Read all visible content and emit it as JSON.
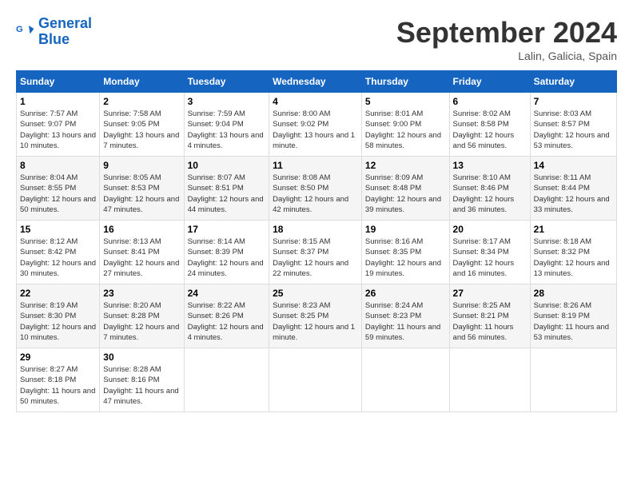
{
  "logo": {
    "line1": "General",
    "line2": "Blue"
  },
  "title": "September 2024",
  "location": "Lalin, Galicia, Spain",
  "weekdays": [
    "Sunday",
    "Monday",
    "Tuesday",
    "Wednesday",
    "Thursday",
    "Friday",
    "Saturday"
  ],
  "weeks": [
    [
      {
        "day": "1",
        "info": "Sunrise: 7:57 AM\nSunset: 9:07 PM\nDaylight: 13 hours and 10 minutes."
      },
      {
        "day": "2",
        "info": "Sunrise: 7:58 AM\nSunset: 9:05 PM\nDaylight: 13 hours and 7 minutes."
      },
      {
        "day": "3",
        "info": "Sunrise: 7:59 AM\nSunset: 9:04 PM\nDaylight: 13 hours and 4 minutes."
      },
      {
        "day": "4",
        "info": "Sunrise: 8:00 AM\nSunset: 9:02 PM\nDaylight: 13 hours and 1 minute."
      },
      {
        "day": "5",
        "info": "Sunrise: 8:01 AM\nSunset: 9:00 PM\nDaylight: 12 hours and 58 minutes."
      },
      {
        "day": "6",
        "info": "Sunrise: 8:02 AM\nSunset: 8:58 PM\nDaylight: 12 hours and 56 minutes."
      },
      {
        "day": "7",
        "info": "Sunrise: 8:03 AM\nSunset: 8:57 PM\nDaylight: 12 hours and 53 minutes."
      }
    ],
    [
      {
        "day": "8",
        "info": "Sunrise: 8:04 AM\nSunset: 8:55 PM\nDaylight: 12 hours and 50 minutes."
      },
      {
        "day": "9",
        "info": "Sunrise: 8:05 AM\nSunset: 8:53 PM\nDaylight: 12 hours and 47 minutes."
      },
      {
        "day": "10",
        "info": "Sunrise: 8:07 AM\nSunset: 8:51 PM\nDaylight: 12 hours and 44 minutes."
      },
      {
        "day": "11",
        "info": "Sunrise: 8:08 AM\nSunset: 8:50 PM\nDaylight: 12 hours and 42 minutes."
      },
      {
        "day": "12",
        "info": "Sunrise: 8:09 AM\nSunset: 8:48 PM\nDaylight: 12 hours and 39 minutes."
      },
      {
        "day": "13",
        "info": "Sunrise: 8:10 AM\nSunset: 8:46 PM\nDaylight: 12 hours and 36 minutes."
      },
      {
        "day": "14",
        "info": "Sunrise: 8:11 AM\nSunset: 8:44 PM\nDaylight: 12 hours and 33 minutes."
      }
    ],
    [
      {
        "day": "15",
        "info": "Sunrise: 8:12 AM\nSunset: 8:42 PM\nDaylight: 12 hours and 30 minutes."
      },
      {
        "day": "16",
        "info": "Sunrise: 8:13 AM\nSunset: 8:41 PM\nDaylight: 12 hours and 27 minutes."
      },
      {
        "day": "17",
        "info": "Sunrise: 8:14 AM\nSunset: 8:39 PM\nDaylight: 12 hours and 24 minutes."
      },
      {
        "day": "18",
        "info": "Sunrise: 8:15 AM\nSunset: 8:37 PM\nDaylight: 12 hours and 22 minutes."
      },
      {
        "day": "19",
        "info": "Sunrise: 8:16 AM\nSunset: 8:35 PM\nDaylight: 12 hours and 19 minutes."
      },
      {
        "day": "20",
        "info": "Sunrise: 8:17 AM\nSunset: 8:34 PM\nDaylight: 12 hours and 16 minutes."
      },
      {
        "day": "21",
        "info": "Sunrise: 8:18 AM\nSunset: 8:32 PM\nDaylight: 12 hours and 13 minutes."
      }
    ],
    [
      {
        "day": "22",
        "info": "Sunrise: 8:19 AM\nSunset: 8:30 PM\nDaylight: 12 hours and 10 minutes."
      },
      {
        "day": "23",
        "info": "Sunrise: 8:20 AM\nSunset: 8:28 PM\nDaylight: 12 hours and 7 minutes."
      },
      {
        "day": "24",
        "info": "Sunrise: 8:22 AM\nSunset: 8:26 PM\nDaylight: 12 hours and 4 minutes."
      },
      {
        "day": "25",
        "info": "Sunrise: 8:23 AM\nSunset: 8:25 PM\nDaylight: 12 hours and 1 minute."
      },
      {
        "day": "26",
        "info": "Sunrise: 8:24 AM\nSunset: 8:23 PM\nDaylight: 11 hours and 59 minutes."
      },
      {
        "day": "27",
        "info": "Sunrise: 8:25 AM\nSunset: 8:21 PM\nDaylight: 11 hours and 56 minutes."
      },
      {
        "day": "28",
        "info": "Sunrise: 8:26 AM\nSunset: 8:19 PM\nDaylight: 11 hours and 53 minutes."
      }
    ],
    [
      {
        "day": "29",
        "info": "Sunrise: 8:27 AM\nSunset: 8:18 PM\nDaylight: 11 hours and 50 minutes."
      },
      {
        "day": "30",
        "info": "Sunrise: 8:28 AM\nSunset: 8:16 PM\nDaylight: 11 hours and 47 minutes."
      },
      {
        "day": "",
        "info": ""
      },
      {
        "day": "",
        "info": ""
      },
      {
        "day": "",
        "info": ""
      },
      {
        "day": "",
        "info": ""
      },
      {
        "day": "",
        "info": ""
      }
    ]
  ]
}
